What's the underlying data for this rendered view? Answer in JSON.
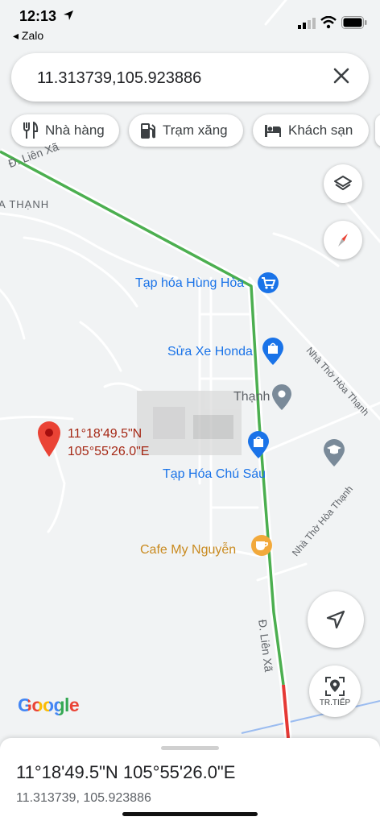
{
  "status": {
    "time": "12:13",
    "back_app": "◂ Zalo"
  },
  "search": {
    "value": "11.313739,105.923886"
  },
  "chips": [
    {
      "label": "Nhà hàng",
      "icon": "restaurant-icon"
    },
    {
      "label": "Trạm xăng",
      "icon": "gas-station-icon"
    },
    {
      "label": "Khách sạn",
      "icon": "hotel-icon"
    }
  ],
  "map": {
    "roads": {
      "top_road": "Đ. Liên Xã",
      "main_road": "Đ. Liên Xã",
      "side_road_1": "Nhà Thờ Hòa Thạnh",
      "side_road_2": "Nhà Thờ Hòa Thạnh",
      "area": "A THẠNH"
    },
    "pois": {
      "tap_hoa_hung_hoa": "Tạp hóa Hùng Hòa",
      "sua_xe_honda": "Sửa Xe Honda",
      "tap_hoa_chu_sau": "Tạp Hóa Chú Sáu",
      "cafe_my_nguyen": "Cafe My Nguyễn",
      "blurred_place": "Thạnh"
    },
    "pin_label_line1": "11°18'49.5\"N",
    "pin_label_line2": "105°55'26.0\"E",
    "logo": "Google",
    "live_view_label": "TR.TIẾP",
    "colors": {
      "traffic_green": "#4caf50",
      "traffic_red": "#e53935",
      "poi_blue": "#1a73e8",
      "poi_orange": "#f2a93b",
      "pin_red": "#ea4335"
    }
  },
  "sheet": {
    "title": "11°18'49.5\"N 105°55'26.0\"E",
    "subtitle": "11.313739, 105.923886"
  }
}
